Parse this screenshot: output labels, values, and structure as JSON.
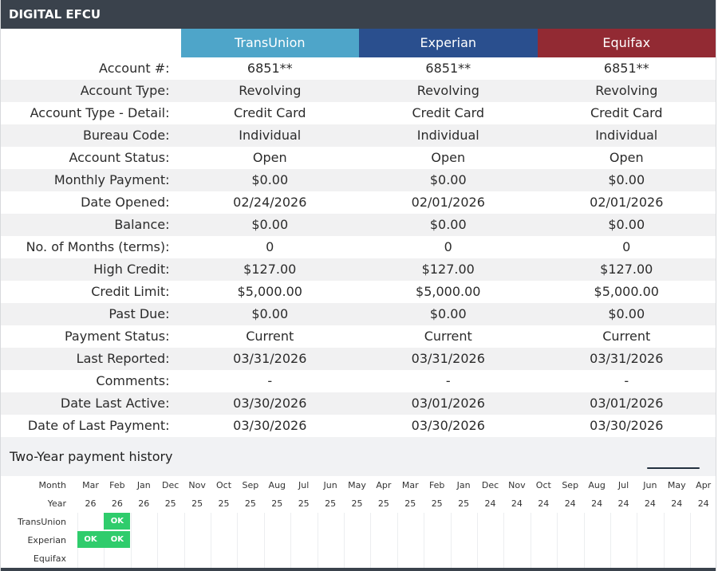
{
  "title": "DIGITAL EFCU",
  "bureaus": [
    "TransUnion",
    "Experian",
    "Equifax"
  ],
  "rows": [
    {
      "label": "Account #:",
      "values": [
        "6851**",
        "6851**",
        "6851**"
      ]
    },
    {
      "label": "Account Type:",
      "values": [
        "Revolving",
        "Revolving",
        "Revolving"
      ]
    },
    {
      "label": "Account Type - Detail:",
      "values": [
        "Credit Card",
        "Credit Card",
        "Credit Card"
      ]
    },
    {
      "label": "Bureau Code:",
      "values": [
        "Individual",
        "Individual",
        "Individual"
      ]
    },
    {
      "label": "Account Status:",
      "values": [
        "Open",
        "Open",
        "Open"
      ]
    },
    {
      "label": "Monthly Payment:",
      "values": [
        "$0.00",
        "$0.00",
        "$0.00"
      ]
    },
    {
      "label": "Date Opened:",
      "values": [
        "02/24/2026",
        "02/01/2026",
        "02/01/2026"
      ]
    },
    {
      "label": "Balance:",
      "values": [
        "$0.00",
        "$0.00",
        "$0.00"
      ]
    },
    {
      "label": "No. of Months (terms):",
      "values": [
        "0",
        "0",
        "0"
      ]
    },
    {
      "label": "High Credit:",
      "values": [
        "$127.00",
        "$127.00",
        "$127.00"
      ]
    },
    {
      "label": "Credit Limit:",
      "values": [
        "$5,000.00",
        "$5,000.00",
        "$5,000.00"
      ]
    },
    {
      "label": "Past Due:",
      "values": [
        "$0.00",
        "$0.00",
        "$0.00"
      ]
    },
    {
      "label": "Payment Status:",
      "values": [
        "Current",
        "Current",
        "Current"
      ]
    },
    {
      "label": "Last Reported:",
      "values": [
        "03/31/2026",
        "03/31/2026",
        "03/31/2026"
      ]
    },
    {
      "label": "Comments:",
      "values": [
        "-",
        "-",
        "-"
      ]
    },
    {
      "label": "Date Last Active:",
      "values": [
        "03/30/2026",
        "03/01/2026",
        "03/01/2026"
      ]
    },
    {
      "label": "Date of Last Payment:",
      "values": [
        "03/30/2026",
        "03/30/2026",
        "03/30/2026"
      ]
    }
  ],
  "history": {
    "title": "Two-Year payment history",
    "month_label": "Month",
    "year_label": "Year",
    "months": [
      "Mar",
      "Feb",
      "Jan",
      "Dec",
      "Nov",
      "Oct",
      "Sep",
      "Aug",
      "Jul",
      "Jun",
      "May",
      "Apr",
      "Mar",
      "Feb",
      "Jan",
      "Dec",
      "Nov",
      "Oct",
      "Sep",
      "Aug",
      "Jul",
      "Jun",
      "May",
      "Apr"
    ],
    "years": [
      "26",
      "26",
      "26",
      "25",
      "25",
      "25",
      "25",
      "25",
      "25",
      "25",
      "25",
      "25",
      "25",
      "25",
      "25",
      "24",
      "24",
      "24",
      "24",
      "24",
      "24",
      "24",
      "24",
      "24"
    ],
    "bureau_rows": [
      {
        "name": "TransUnion",
        "statuses": [
          "",
          "OK"
        ]
      },
      {
        "name": "Experian",
        "statuses": [
          "OK",
          "OK"
        ]
      },
      {
        "name": "Equifax",
        "statuses": []
      }
    ]
  },
  "colors": {
    "title_bar": "#3a424c",
    "transunion": "#4ea5c9",
    "experian": "#2a4f8e",
    "equifax": "#922a33",
    "ok_badge": "#2fcc6c"
  }
}
